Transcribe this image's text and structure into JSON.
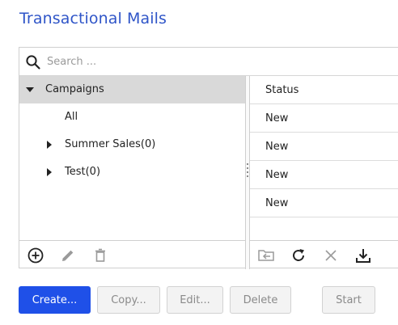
{
  "page": {
    "title": "Transactional Mails"
  },
  "search": {
    "placeholder": "Search ...",
    "value": ""
  },
  "tree": {
    "items": [
      {
        "label": "Campaigns",
        "state": "expanded",
        "selected": true
      },
      {
        "label": "All",
        "state": "leaf"
      },
      {
        "label": "Summer Sales(0)",
        "state": "collapsed"
      },
      {
        "label": "Test(0)",
        "state": "collapsed"
      }
    ]
  },
  "list": {
    "header": "Status",
    "rows": [
      "New",
      "New",
      "New",
      "New"
    ]
  },
  "toolbar_left": {
    "icons": [
      "add-circle-icon",
      "pencil-icon",
      "trash-icon"
    ]
  },
  "toolbar_right": {
    "icons": [
      "move-to-folder-icon",
      "refresh-icon",
      "close-icon",
      "download-icon"
    ]
  },
  "actions": {
    "create": "Create...",
    "copy": "Copy...",
    "edit": "Edit...",
    "delete": "Delete",
    "start": "Start"
  },
  "colors": {
    "title": "#2f55c8",
    "primary_button": "#1f50e8",
    "selected_row": "#d9d9d9",
    "border": "#cfcfcf"
  }
}
